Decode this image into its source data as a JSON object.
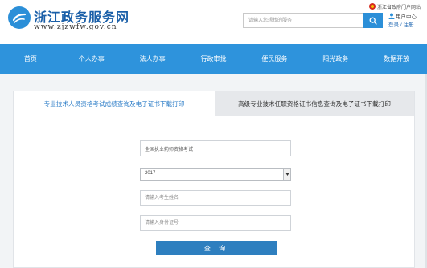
{
  "header": {
    "title": "浙江政务服务网",
    "url": "www.zjzwfw.gov.cn",
    "search_placeholder": "请输入您想找的服务",
    "portal_link": "浙江省政府门户网站",
    "user_center": "用户中心",
    "login": "登录",
    "separator": "/",
    "register": "注册"
  },
  "nav": {
    "items": [
      {
        "label": "首页"
      },
      {
        "label": "个人办事"
      },
      {
        "label": "法人办事"
      },
      {
        "label": "行政审批"
      },
      {
        "label": "便民服务"
      },
      {
        "label": "阳光政务"
      },
      {
        "label": "数据开放"
      }
    ]
  },
  "tabs": [
    {
      "label": "专业技术人员资格考试成绩查询及电子证书下载打印",
      "active": true
    },
    {
      "label": "高级专业技术任职资格证书信息查询及电子证书下载打印",
      "active": false
    }
  ],
  "form": {
    "exam_field_value": "全国执业药师资格考试",
    "year_selected": "2017",
    "name_placeholder": "请输入考生姓名",
    "id_placeholder": "请输入身份证号",
    "query_button": "查 询"
  },
  "colors": {
    "brand": "#2e93dc",
    "button": "#2e7fbf",
    "active_tab_text": "#2b7cc7"
  }
}
